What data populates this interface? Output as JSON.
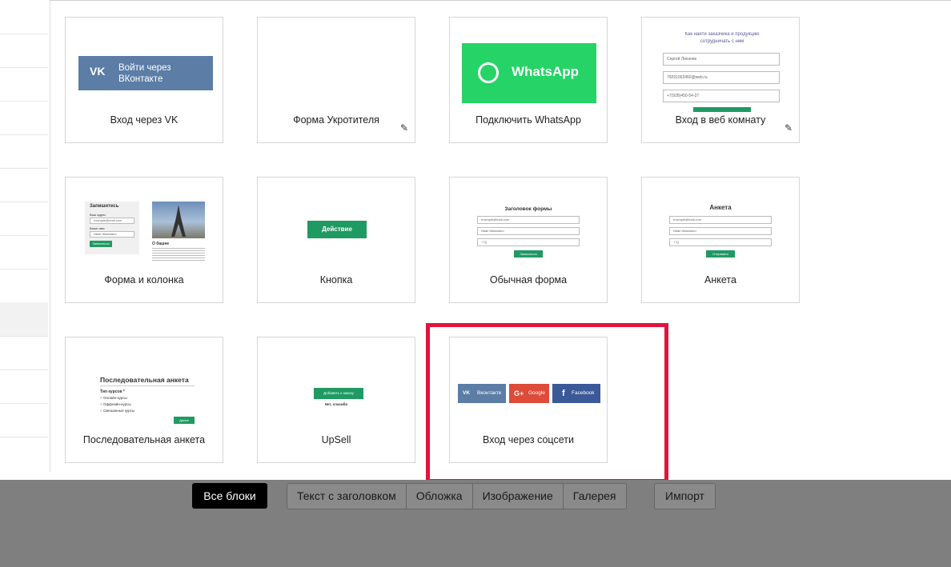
{
  "cards": [
    {
      "caption": "Вход через VK",
      "preview": {
        "button_text": "Войти через ВКонтакте",
        "logo": "vk-logo"
      }
    },
    {
      "caption": "Форма Укротителя",
      "edit_icon": "pencil-icon"
    },
    {
      "caption": "Подключить WhatsApp",
      "preview": {
        "label": "WhatsApp",
        "icon": "whatsapp-icon"
      }
    },
    {
      "caption": "Вход в веб комнату",
      "edit_icon": "pencil-icon",
      "preview": {
        "header_line1": "Как найти заказчика и продукцию",
        "header_line2": "сотрудничать с ним",
        "name": "Сергей Лихачев",
        "email": "79291002450@web.ru",
        "phone": "+7(928)450-54-27"
      }
    },
    {
      "caption": "Форма и колонка",
      "preview": {
        "title": "Запишитесь",
        "label1": "Ваш адрес",
        "placeholder1": "example@mail.com",
        "label2": "Ваше имя",
        "placeholder2": "Иван Иванович",
        "button": "Записаться",
        "col_title": "О башне"
      }
    },
    {
      "caption": "Кнопка",
      "preview": {
        "button": "Действие"
      }
    },
    {
      "caption": "Обычная форма",
      "preview": {
        "title": "Заголовок формы",
        "field1": "example@mail.com",
        "field2": "Иван Иванович",
        "field3": "+7()",
        "button": "Записаться"
      }
    },
    {
      "caption": "Анкета",
      "preview": {
        "title": "Анкета",
        "field1": "example@mail.com",
        "field2": "Иван Иванович",
        "field3": "+7()",
        "button": "Отправить"
      }
    },
    {
      "caption": "Последовательная анкета",
      "preview": {
        "title": "Последовательная анкета",
        "question": "Тип курсов *",
        "opt1": "Онлайн-курсы",
        "opt2": "Оффлайн-курсы",
        "opt3": "Смешанные курсы",
        "button": "Далее"
      }
    },
    {
      "caption": "UpSell",
      "preview": {
        "button": "Добавить к заказу",
        "decline": "Нет, спасибо"
      }
    },
    {
      "caption": "Вход через соцсети",
      "preview": {
        "vk": "Вконтакте",
        "google": "Google",
        "facebook": "Facebook"
      }
    }
  ],
  "tabs": {
    "all": "Все блоки",
    "group": [
      "Текст с заголовком",
      "Обложка",
      "Изображение",
      "Галерея"
    ],
    "import": "Импорт"
  },
  "colors": {
    "highlight": "#e0143c",
    "vk": "#5b7da6",
    "whatsapp": "#25d366",
    "google": "#dd4b39",
    "facebook": "#3b5998",
    "green": "#1f9a62"
  }
}
